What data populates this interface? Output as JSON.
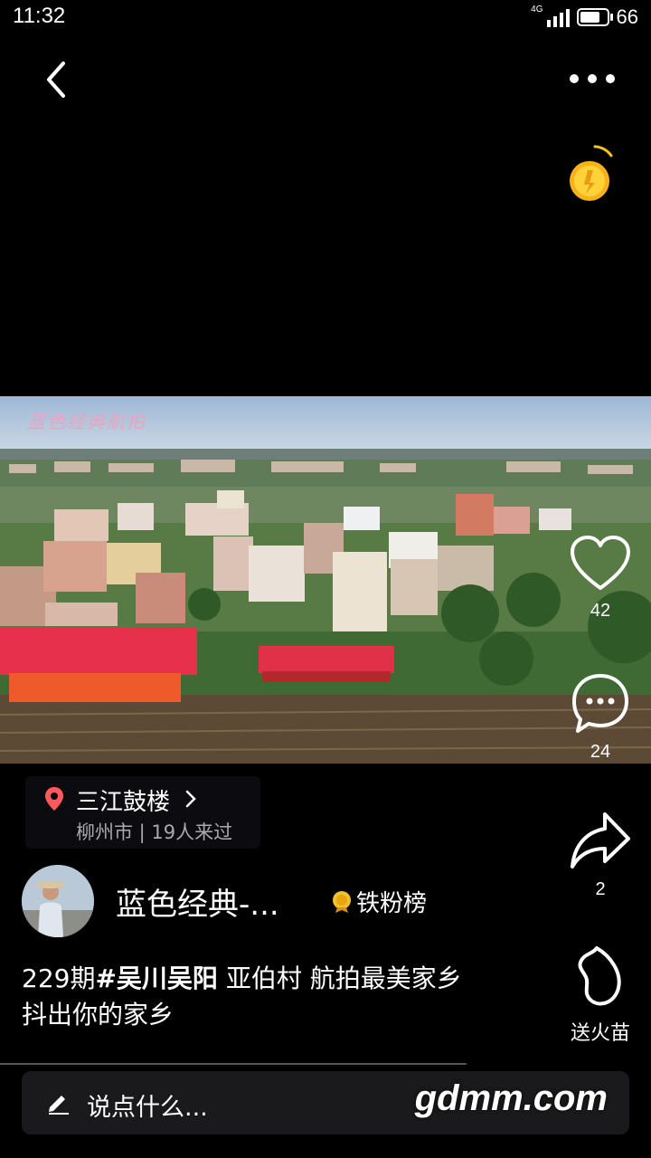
{
  "status": {
    "time": "11:32",
    "network": "4G",
    "battery": "66"
  },
  "video": {
    "watermark": "蓝色经典航拍"
  },
  "actions": {
    "like_count": "42",
    "comment_count": "24",
    "share_count": "2",
    "gift_label": "送火苗"
  },
  "location": {
    "name": "三江鼓楼",
    "city_visits": "柳州市 | 19人来过"
  },
  "author": {
    "name": "蓝色经典-...",
    "badge": "铁粉榜"
  },
  "caption": {
    "episode": "229期",
    "hashtag": "#吴川吴阳",
    "text": " 亚伯村 航拍最美家乡  抖出你的家乡"
  },
  "comment_box": {
    "placeholder": "说点什么..."
  },
  "site_watermark": "gdmm.com"
}
